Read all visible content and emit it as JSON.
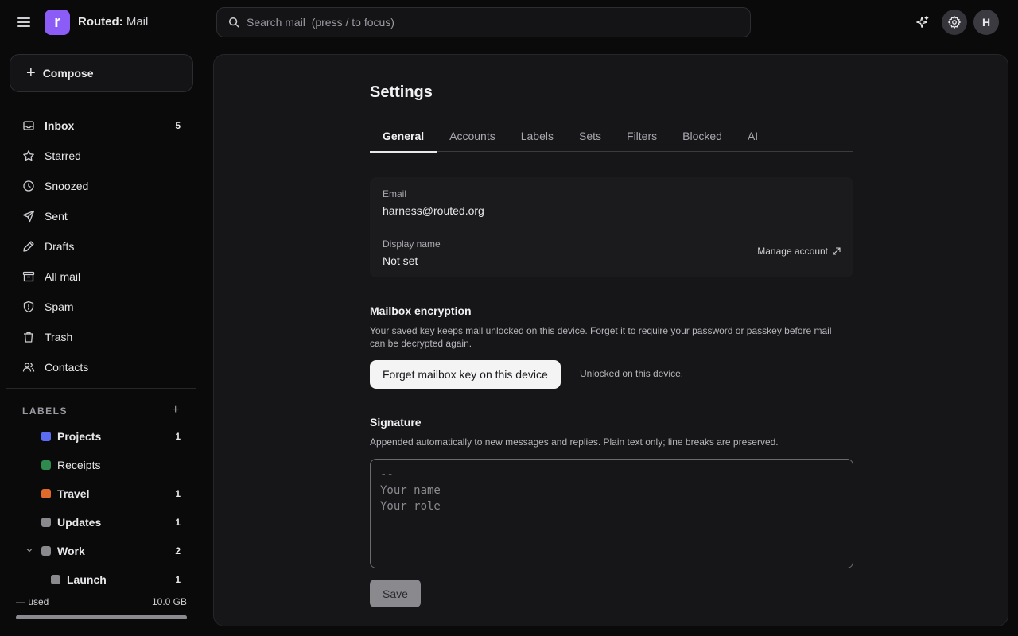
{
  "app": {
    "brand_prefix": "Routed:",
    "brand_name": "Mail",
    "logo_letter": "r",
    "accent": "#8b5cf6"
  },
  "search": {
    "placeholder": "Search mail  (press / to focus)"
  },
  "header": {
    "avatar_initial": "H"
  },
  "compose": {
    "label": "Compose"
  },
  "nav": [
    {
      "label": "Inbox",
      "count": "5",
      "icon": "inbox-icon"
    },
    {
      "label": "Starred",
      "count": "",
      "icon": "star-icon"
    },
    {
      "label": "Snoozed",
      "count": "",
      "icon": "clock-icon"
    },
    {
      "label": "Sent",
      "count": "",
      "icon": "send-icon"
    },
    {
      "label": "Drafts",
      "count": "",
      "icon": "pencil-icon"
    },
    {
      "label": "All mail",
      "count": "",
      "icon": "archive-icon"
    },
    {
      "label": "Spam",
      "count": "",
      "icon": "shield-icon"
    },
    {
      "label": "Trash",
      "count": "",
      "icon": "trash-icon"
    },
    {
      "label": "Contacts",
      "count": "",
      "icon": "users-icon"
    }
  ],
  "labels": {
    "heading": "LABELS",
    "items": [
      {
        "label": "Projects",
        "count": "1",
        "color": "#5b6cf0"
      },
      {
        "label": "Receipts",
        "count": "",
        "color": "#2e8a4f"
      },
      {
        "label": "Travel",
        "count": "1",
        "color": "#e06a2c"
      },
      {
        "label": "Updates",
        "count": "1",
        "color": "#8a8a8e"
      },
      {
        "label": "Work",
        "count": "2",
        "color": "#8a8a8e"
      },
      {
        "label": "Launch",
        "count": "1",
        "color": "#8a8a8e"
      }
    ]
  },
  "storage": {
    "used": "— used",
    "total": "10.0 GB",
    "fraction": 1.0
  },
  "settings": {
    "title": "Settings",
    "tabs": [
      "General",
      "Accounts",
      "Labels",
      "Sets",
      "Filters",
      "Blocked",
      "AI"
    ],
    "email_label": "Email",
    "email_value": "harness@routed.org",
    "display_name_label": "Display name",
    "display_name_value": "Not set",
    "manage_account": "Manage account",
    "encryption_title": "Mailbox encryption",
    "encryption_desc": "Your saved key keeps mail unlocked on this device. Forget it to require your password or passkey before mail can be decrypted again.",
    "forget_button": "Forget mailbox key on this device",
    "unlock_status": "Unlocked on this device.",
    "signature_title": "Signature",
    "signature_desc": "Appended automatically to new messages and replies. Plain text only; line breaks are preserved.",
    "signature_placeholder": "--\nYour name\nYour role",
    "save_button": "Save"
  }
}
